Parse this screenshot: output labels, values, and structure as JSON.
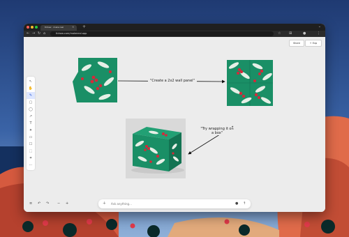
{
  "browser": {
    "tab_title": "tldraw · make real",
    "tab_close": "×",
    "new_tab": "+",
    "tab_menu": "⌄",
    "url": "tldraw.com/makereal.app",
    "toolbar_icons": {
      "back": "←",
      "forward": "→",
      "reload": "↻",
      "home": "⌂",
      "star": "☆",
      "extensions": "⊞",
      "profile": "●",
      "menu": "⋮"
    }
  },
  "app": {
    "top_buttons": {
      "share": "Share",
      "export": "⇪ Exp"
    },
    "tools": [
      "↖",
      "✋",
      "✎",
      "▢",
      "◯",
      "↗",
      "T",
      "✦",
      "▭",
      "☐",
      "⬚",
      "⌗",
      "⋯"
    ],
    "bottom_left": {
      "menu": "≡",
      "undo": "↶",
      "redo": "↷",
      "zoom_out": "−",
      "zoom_in": "+"
    },
    "chat": {
      "placeholder": "Ask anything...",
      "attach_icon": "＋",
      "mic_icon": "●",
      "send_icon": "↑"
    }
  },
  "canvas": {
    "arrow_label_1": "\"Create a 2x2 wall panel\"",
    "arrow_label_2": "\"Try wrapping it on a box\""
  },
  "colors": {
    "pattern_bg": "#1a8f66",
    "leaf": "#e6efe6",
    "berry": "#d6283a",
    "box_shadow": "#c9c9c9"
  }
}
